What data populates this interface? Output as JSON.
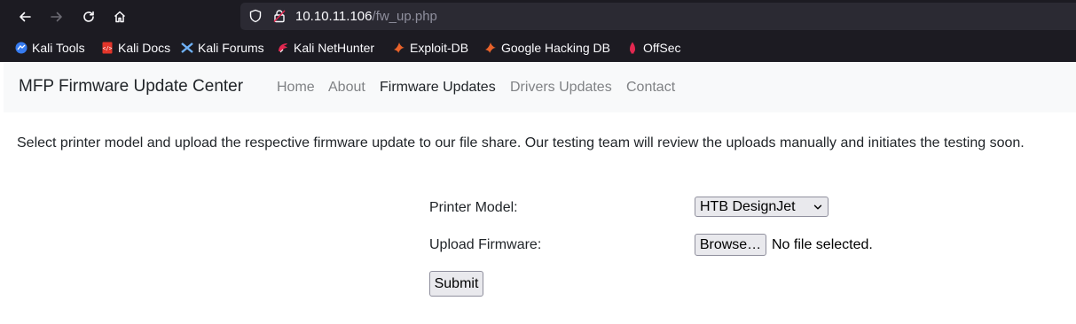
{
  "browser": {
    "url_host": "10.10.11.106",
    "url_path": "/fw_up.php",
    "bookmarks": [
      {
        "label": "Kali Tools",
        "icon": "kali-tools-icon"
      },
      {
        "label": "Kali Docs",
        "icon": "kali-docs-icon"
      },
      {
        "label": "Kali Forums",
        "icon": "kali-forums-icon"
      },
      {
        "label": "Kali NetHunter",
        "icon": "kali-nethunter-icon"
      },
      {
        "label": "Exploit-DB",
        "icon": "exploit-db-icon"
      },
      {
        "label": "Google Hacking DB",
        "icon": "google-hacking-db-icon"
      },
      {
        "label": "OffSec",
        "icon": "offsec-icon"
      }
    ]
  },
  "navbar": {
    "brand": "MFP Firmware Update Center",
    "links": [
      {
        "label": "Home",
        "active": false
      },
      {
        "label": "About",
        "active": false
      },
      {
        "label": "Firmware Updates",
        "active": true
      },
      {
        "label": "Drivers Updates",
        "active": false
      },
      {
        "label": "Contact",
        "active": false
      }
    ]
  },
  "main": {
    "intro": "Select printer model and upload the respective firmware update to our file share. Our testing team will review the uploads manually and initiates the testing soon.",
    "form": {
      "printer_model_label": "Printer Model:",
      "printer_model_value": "HTB DesignJet",
      "upload_label": "Upload Firmware:",
      "browse_label": "Browse…",
      "no_file_text": "No file selected.",
      "submit_label": "Submit"
    }
  },
  "colors": {
    "chrome_bg": "#1c1b22",
    "urlbar_bg": "#2b2a33",
    "navbar_bg": "#f8f9fa",
    "nav_link": "#808285",
    "nav_link_active": "#212529",
    "button_bg": "#e9e9ed"
  }
}
